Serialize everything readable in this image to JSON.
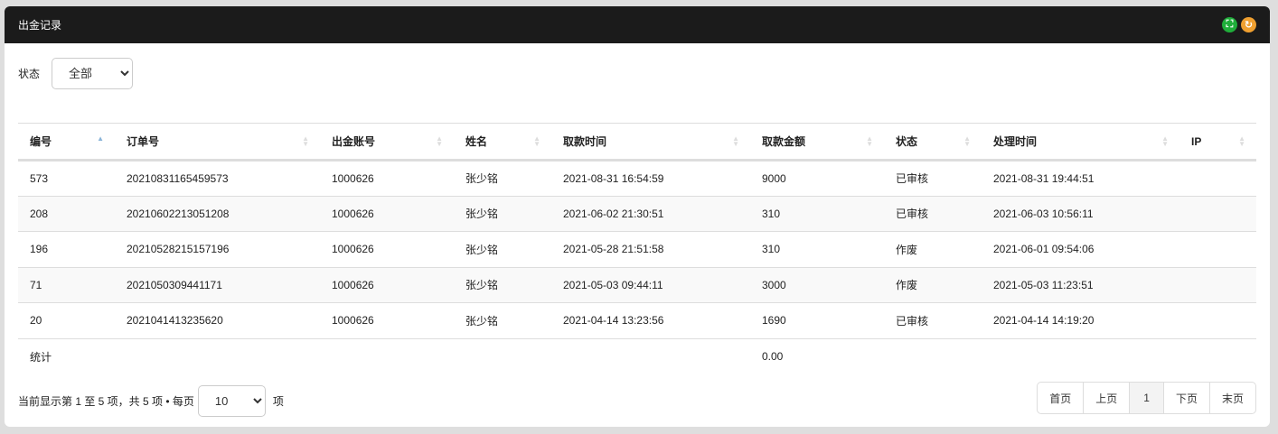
{
  "header": {
    "title": "出金记录",
    "icons": [
      "fullscreen-icon",
      "refresh-icon"
    ],
    "colors": {
      "fullscreen": "#1fae3a",
      "refresh": "#f0a030"
    }
  },
  "filter": {
    "label": "状态",
    "value": "全部"
  },
  "table": {
    "columns": [
      "编号",
      "订单号",
      "出金账号",
      "姓名",
      "取款时间",
      "取款金额",
      "状态",
      "处理时间",
      "IP"
    ],
    "rows": [
      [
        "573",
        "20210831165459573",
        "1000626",
        "张少铭",
        "2021-08-31 16:54:59",
        "9000",
        "已审核",
        "2021-08-31 19:44:51",
        ""
      ],
      [
        "208",
        "20210602213051208",
        "1000626",
        "张少铭",
        "2021-06-02 21:30:51",
        "310",
        "已审核",
        "2021-06-03 10:56:11",
        ""
      ],
      [
        "196",
        "20210528215157196",
        "1000626",
        "张少铭",
        "2021-05-28 21:51:58",
        "310",
        "作废",
        "2021-06-01 09:54:06",
        ""
      ],
      [
        "71",
        "2021050309441171",
        "1000626",
        "张少铭",
        "2021-05-03 09:44:11",
        "3000",
        "作废",
        "2021-05-03 11:23:51",
        ""
      ],
      [
        "20",
        "2021041413235620",
        "1000626",
        "张少铭",
        "2021-04-14 13:23:56",
        "1690",
        "已审核",
        "2021-04-14 14:19:20",
        ""
      ]
    ],
    "summary": {
      "label": "统计",
      "amount": "0.00"
    }
  },
  "footer": {
    "info": "当前显示第 1 至 5 项，共 5 项 • 每页",
    "page_size": "10",
    "suffix": "项"
  },
  "pager": {
    "first": "首页",
    "prev": "上页",
    "current": "1",
    "next": "下页",
    "last": "末页"
  }
}
